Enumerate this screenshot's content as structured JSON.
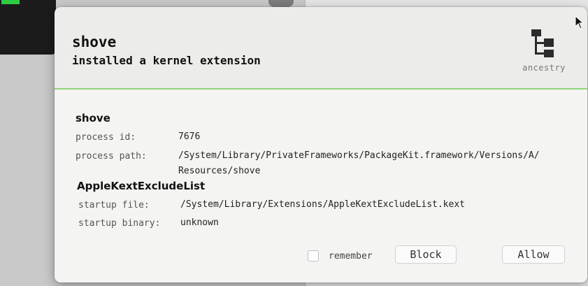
{
  "background": {
    "terminal_color": "#1b1b1b",
    "prompt_color": "#2ecc40"
  },
  "dialog": {
    "accent_color": "#8fd47c",
    "process_name": "shove",
    "event_description": "installed a kernel extension",
    "ancestry_icon": "hierarchy-icon",
    "ancestry_label": "ancestry"
  },
  "process": {
    "title": "shove",
    "rows": [
      {
        "key": "process id:",
        "value": "7676"
      },
      {
        "key": "process path:",
        "value_line1": "/System/Library/PrivateFrameworks/PackageKit.framework/Versions/A/",
        "value_line2": "Resources/shove"
      }
    ]
  },
  "item": {
    "title": "AppleKextExcludeList",
    "rows": [
      {
        "key": "startup file:",
        "value": "/System/Library/Extensions/AppleKextExcludeList.kext"
      },
      {
        "key": "startup binary:",
        "value": "unknown"
      }
    ]
  },
  "actions": {
    "remember_label": "remember",
    "remember_checked": false,
    "block_label": "Block",
    "allow_label": "Allow"
  }
}
